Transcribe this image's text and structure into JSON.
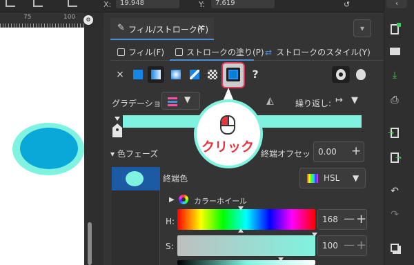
{
  "toolbar_top": {
    "x_label": "X:",
    "x_value": "19.948",
    "y_label": "Y:",
    "y_value": "7.619"
  },
  "ruler": {
    "mark1": "75",
    "mark2": "100"
  },
  "dock_tab": {
    "label": "フィル/ストローク(F)",
    "close": "×"
  },
  "subtabs": {
    "fill": "フィル(F)",
    "stroke_paint": "ストロークの塗り(P)",
    "stroke_style": "ストロークのスタイル(Y)"
  },
  "paint": {
    "unset": "?",
    "none": "×"
  },
  "gradient": {
    "label": "グラデーション:",
    "repeat_label": "繰り返し:",
    "repeat_icon": "↦"
  },
  "stops": {
    "label": "▾ 色フェーズ",
    "offset_label": "終端オフセット:",
    "offset_value": "0.00",
    "plus": "+"
  },
  "stop_color": {
    "label": "終端色",
    "mode": "HSL"
  },
  "wheel": {
    "label": "カラーホイール"
  },
  "hsl": {
    "h_label": "H:",
    "h_value": "168",
    "s_label": "S:",
    "s_value": "100",
    "minus": "—",
    "plus": "+"
  },
  "callout": {
    "text": "クリック"
  },
  "colors": {
    "accent": "#4a90d9",
    "stop": "#7ff3df",
    "ellipse": "#0aa8d8",
    "ring": "#7ff3df",
    "highlight": "#e0355a"
  }
}
